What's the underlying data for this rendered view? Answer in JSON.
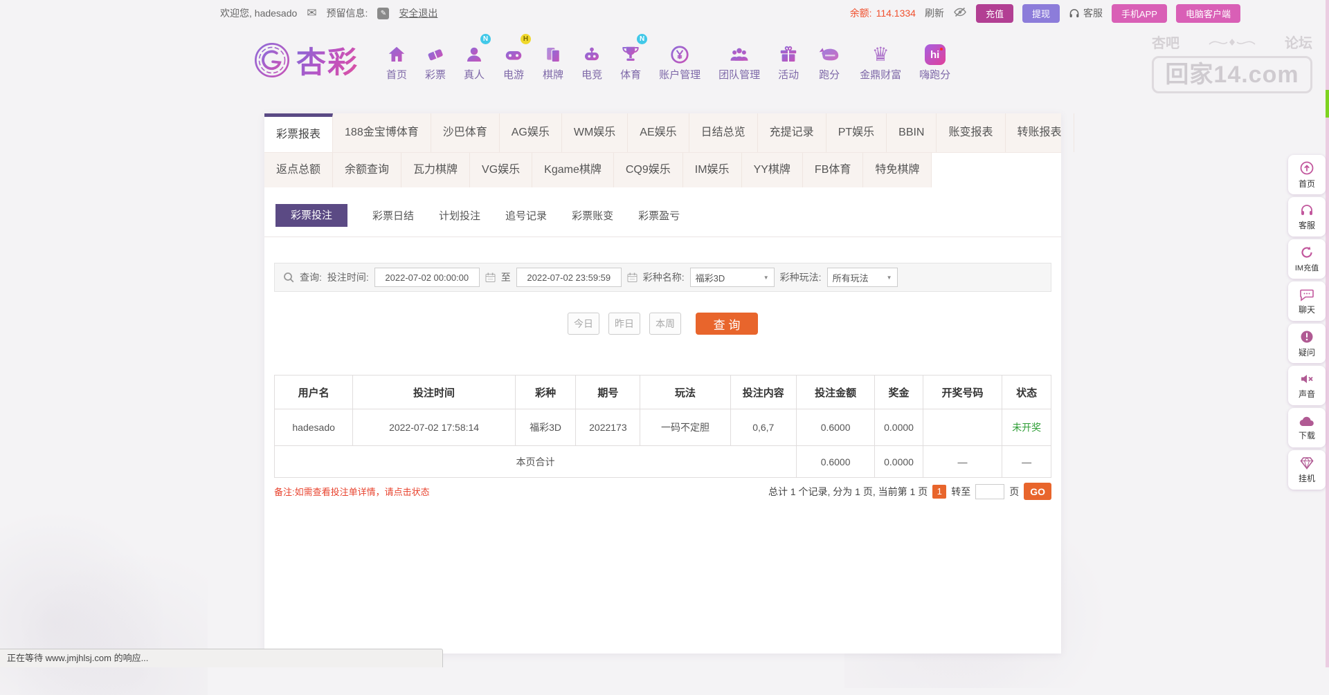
{
  "topbar": {
    "welcome": "欢迎您, hadesado",
    "reserved_label": "预留信息:",
    "logout": "安全退出",
    "balance_label": "余额:",
    "balance_value": "114.1334",
    "refresh_label": "刷新",
    "recharge_btn": "充值",
    "withdraw_btn": "提现",
    "service_label": "客服",
    "mobile_app_btn": "手机APP",
    "pc_client_btn": "电脑客户端"
  },
  "header": {
    "logo_text": "杏彩",
    "nav": [
      {
        "label": "首页",
        "badge": ""
      },
      {
        "label": "彩票",
        "badge": ""
      },
      {
        "label": "真人",
        "badge": "N"
      },
      {
        "label": "电游",
        "badge": "H"
      },
      {
        "label": "棋牌",
        "badge": ""
      },
      {
        "label": "电竞",
        "badge": ""
      },
      {
        "label": "体育",
        "badge": "N"
      },
      {
        "label": "账户管理",
        "badge": ""
      },
      {
        "label": "团队管理",
        "badge": ""
      },
      {
        "label": "活动",
        "badge": ""
      },
      {
        "label": "跑分",
        "badge": ""
      },
      {
        "label": "金鼎财富",
        "badge": ""
      },
      {
        "label": "嗨跑分",
        "badge": ""
      }
    ],
    "hi_icon_text": "hi",
    "watermark": {
      "left": "杏吧",
      "right": "论坛",
      "domain": "回家14.com"
    }
  },
  "tabs": {
    "row1": [
      "彩票报表",
      "188金宝博体育",
      "沙巴体育",
      "AG娱乐",
      "WM娱乐",
      "AE娱乐",
      "日结总览",
      "充提记录",
      "PT娱乐",
      "BBIN",
      "账变报表",
      "转账报表"
    ],
    "row2": [
      "返点总额",
      "余额查询",
      "瓦力棋牌",
      "VG娱乐",
      "Kgame棋牌",
      "CQ9娱乐",
      "IM娱乐",
      "YY棋牌",
      "FB体育",
      "特免棋牌"
    ],
    "active": "彩票报表"
  },
  "subtabs": {
    "items": [
      "彩票投注",
      "彩票日结",
      "计划投注",
      "追号记录",
      "彩票账变",
      "彩票盈亏"
    ],
    "active": "彩票投注"
  },
  "query": {
    "search_label": "查询:",
    "time_label": "投注时间:",
    "time_from": "2022-07-02 00:00:00",
    "to_label": "至",
    "time_to": "2022-07-02 23:59:59",
    "lottery_label": "彩种名称:",
    "lottery_value": "福彩3D",
    "play_label": "彩种玩法:",
    "play_value": "所有玩法",
    "quick": [
      "今日",
      "昨日",
      "本周"
    ],
    "submit": "查 询"
  },
  "table": {
    "headers": [
      "用户名",
      "投注时间",
      "彩种",
      "期号",
      "玩法",
      "投注内容",
      "投注金额",
      "奖金",
      "开奖号码",
      "状态"
    ],
    "row": {
      "username": "hadesado",
      "bet_time": "2022-07-02 17:58:14",
      "lottery": "福彩3D",
      "issue": "2022173",
      "play": "一码不定胆",
      "content": "0,6,7",
      "amount": "0.6000",
      "prize": "0.0000",
      "draw_number": "",
      "status": "未开奖"
    },
    "footer": {
      "label": "本页合计",
      "amount": "0.6000",
      "prize": "0.0000",
      "draw_dash": "—",
      "status_dash": "—"
    }
  },
  "note": "备注:如需查看投注单详情，请点击状态",
  "pagination": {
    "summary": "总计 1 个记录, 分为 1 页, 当前第 1 页",
    "current": "1",
    "goto_label": "转至",
    "page_label": "页",
    "go": "GO"
  },
  "sidebar": {
    "items": [
      {
        "label": "首页"
      },
      {
        "label": "客服"
      },
      {
        "label": "IM充值"
      },
      {
        "label": "聊天"
      },
      {
        "label": "疑问"
      },
      {
        "label": "声音"
      },
      {
        "label": "下载"
      },
      {
        "label": "挂机"
      }
    ]
  },
  "statusbar": "正在等待 www.jmjhlsj.com 的响应...",
  "colors": {
    "accent_orange": "#e8652c",
    "tab_purple": "#5b4a84",
    "pink_button": "#d95fb6",
    "magenta_button": "#b23f93",
    "violet_button": "#8c7cda",
    "status_green": "#2e9e36",
    "note_red": "#e8432e",
    "balance_orange": "#f0502e"
  }
}
